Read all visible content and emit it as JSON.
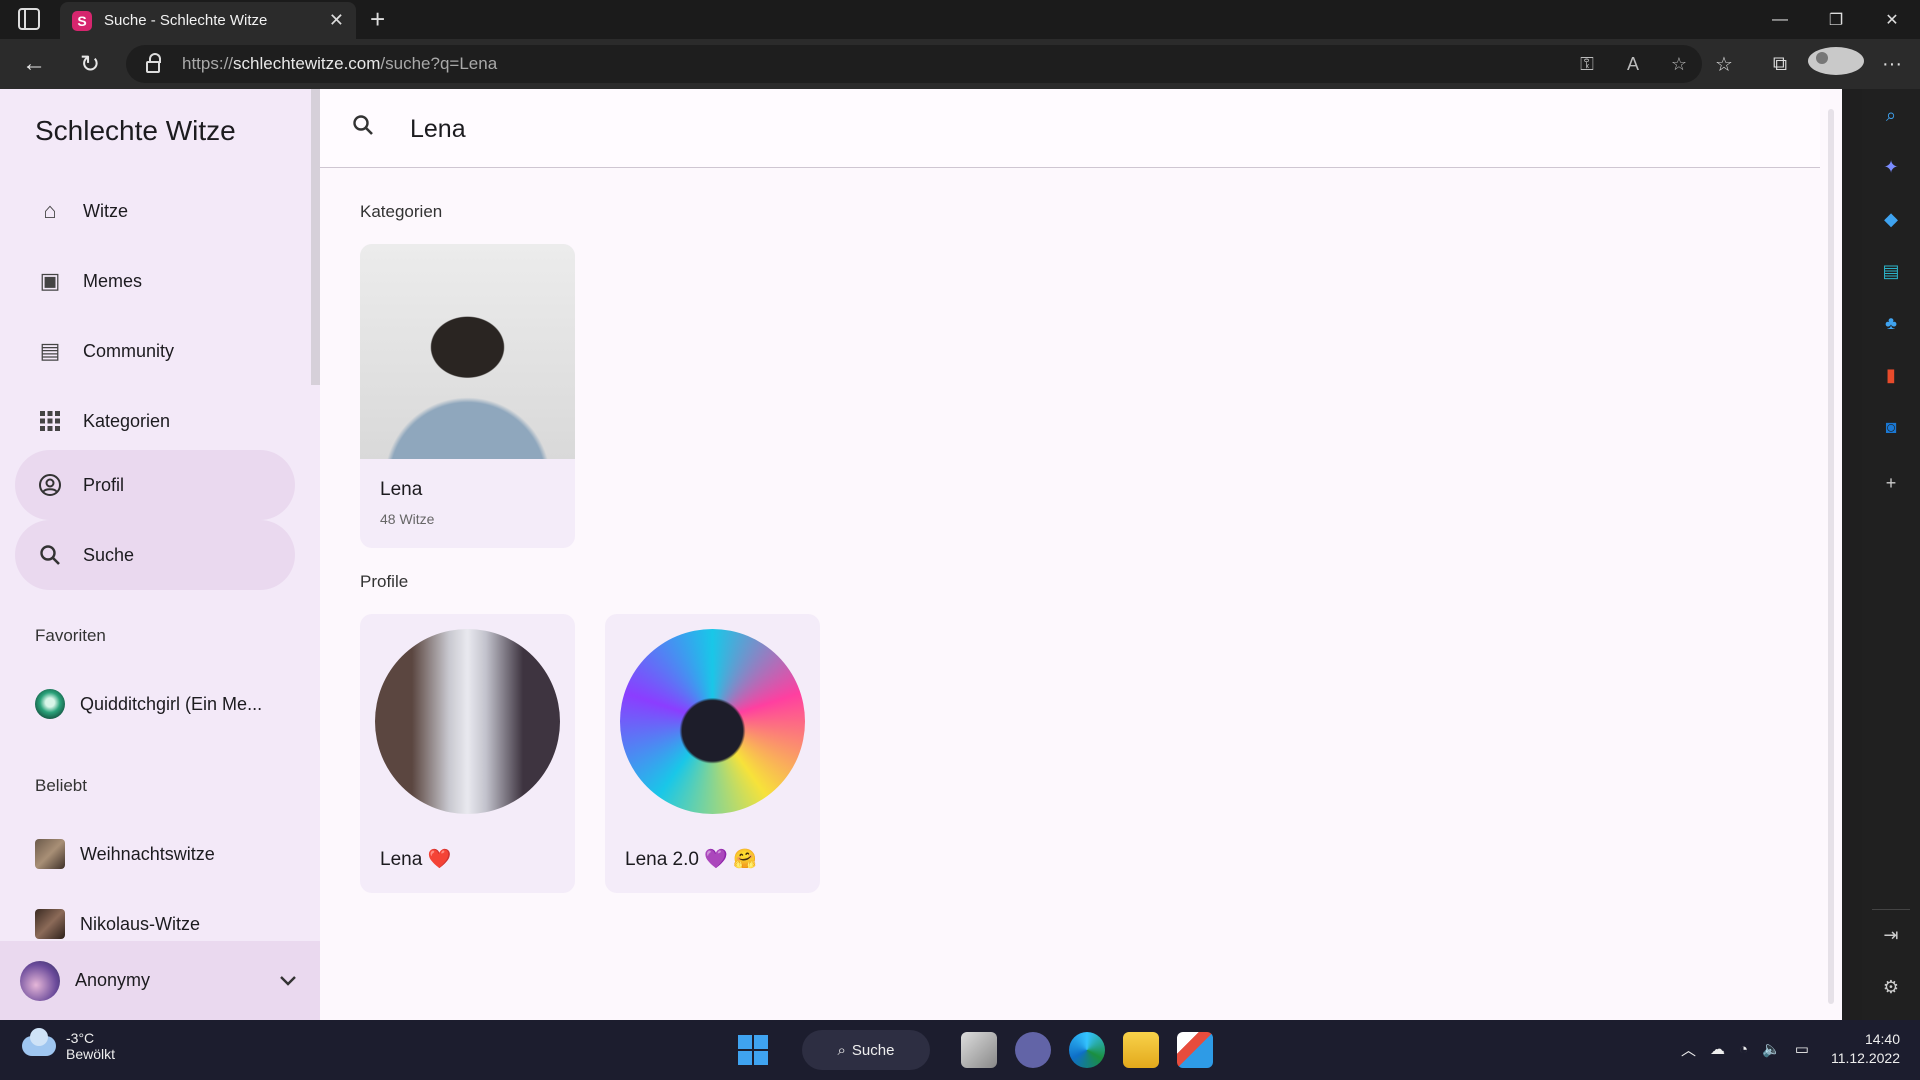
{
  "browser": {
    "tab_title": "Suche - Schlechte Witze",
    "tab_favicon_letter": "S",
    "url_host": "schlechtewitze.com",
    "url_prefix": "https://",
    "url_path": "/suche?q=Lena"
  },
  "sidebar": {
    "brand": "Schlechte Witze",
    "nav": [
      {
        "label": "Witze",
        "icon": "home-icon"
      },
      {
        "label": "Memes",
        "icon": "images-icon"
      },
      {
        "label": "Community",
        "icon": "chat-icon"
      },
      {
        "label": "Kategorien",
        "icon": "grid-icon"
      },
      {
        "label": "Profil",
        "icon": "profile-icon"
      },
      {
        "label": "Suche",
        "icon": "search-icon"
      }
    ],
    "favorites_label": "Favoriten",
    "favorites": [
      {
        "label": "Quidditchgirl (Ein Me..."
      }
    ],
    "popular_label": "Beliebt",
    "popular": [
      {
        "label": "Weihnachtswitze"
      },
      {
        "label": "Nikolaus-Witze"
      }
    ],
    "user": {
      "name": "Anonymy"
    }
  },
  "search": {
    "query": "Lena"
  },
  "results": {
    "categories_label": "Kategorien",
    "categories": [
      {
        "name": "Lena",
        "count": "48 Witze"
      }
    ],
    "profiles_label": "Profile",
    "profiles": [
      {
        "name": "Lena ❤️"
      },
      {
        "name": "Lena 2.0 💜 🤗"
      }
    ]
  },
  "taskbar": {
    "temperature": "-3°C",
    "weather": "Bewölkt",
    "search_label": "Suche",
    "time": "14:40",
    "date": "11.12.2022"
  },
  "colors": {
    "sidebar_bg": "#f3e9f8",
    "active_nav": "#ead9ef",
    "page_bg": "#fdf8fd",
    "card_bg": "#f4ecf9"
  }
}
